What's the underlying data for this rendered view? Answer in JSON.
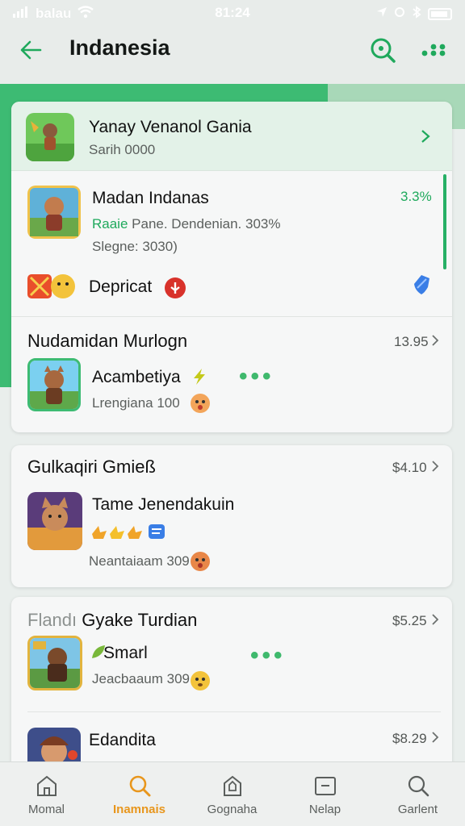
{
  "status_bar": {
    "carrier": "balau",
    "time": "81:24"
  },
  "header": {
    "title": "Indanesia"
  },
  "featured": {
    "title": "Yanay Venanol Gania",
    "subtitle": "Sarih 0000"
  },
  "app1": {
    "name": "Madan Indanas",
    "percent": "3.3%",
    "tag": "Raaie",
    "meta": "Pane. Dendenian. 303%",
    "sub": "Slegne: 3030)"
  },
  "app1_action": {
    "label": "Depricat"
  },
  "section1": {
    "title": "Nudamidan Murlogn",
    "price": "13.95"
  },
  "app2": {
    "name": "Acambetiya",
    "sub": "Lrengiana 100"
  },
  "section2": {
    "title": "Gulkaqiri Gmieß",
    "price": "$4.10"
  },
  "app3": {
    "name": "Tame Jenendakuin",
    "sub": "Neantaiaam 309"
  },
  "section3": {
    "title_faded": "Flandı",
    "title": "Gyake Turdian",
    "price": "$5.25"
  },
  "app4": {
    "name": "Smarl",
    "sub": "Jeacbaaum 309"
  },
  "section4": {
    "title": "Edandita",
    "price": "$8.29"
  },
  "nav": [
    {
      "label": "Momal",
      "icon": "home-icon"
    },
    {
      "label": "Inamnais",
      "icon": "search-icon"
    },
    {
      "label": "Gognaha",
      "icon": "bookmark-home-icon"
    },
    {
      "label": "Nelap",
      "icon": "inbox-icon"
    },
    {
      "label": "Garlent",
      "icon": "search-icon"
    }
  ],
  "colors": {
    "accent": "#1fa95c",
    "band": "#3dbb73",
    "nav_active": "#e8961c",
    "badge_red": "#d8322b",
    "badge_blue": "#3a7ee6"
  }
}
